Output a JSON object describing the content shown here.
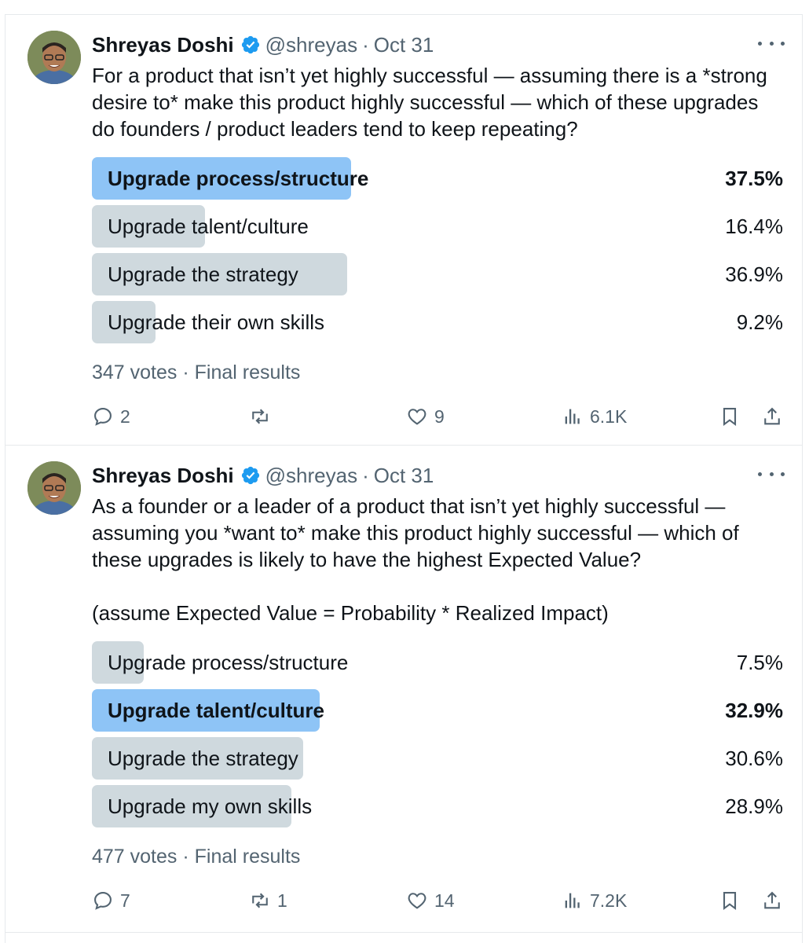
{
  "tweets": [
    {
      "author": "Shreyas Doshi",
      "handle": "@shreyas",
      "separator": "·",
      "date": "Oct 31",
      "text": "For a product that isn’t yet highly successful — assuming there is a *strong\ndesire to* make this product highly successful — which of these upgrades\ndo founders / product leaders tend to keep repeating?",
      "poll": {
        "options": [
          {
            "label": "Upgrade process/structure",
            "pct_label": "37.5%",
            "pct": 37.5,
            "winner": true
          },
          {
            "label": "Upgrade talent/culture",
            "pct_label": "16.4%",
            "pct": 16.4,
            "winner": false
          },
          {
            "label": "Upgrade the strategy",
            "pct_label": "36.9%",
            "pct": 36.9,
            "winner": false
          },
          {
            "label": "Upgrade their own skills",
            "pct_label": "9.2%",
            "pct": 9.2,
            "winner": false
          }
        ],
        "votes": "347 votes · Final results"
      },
      "actions": {
        "replies": "2",
        "reposts": "",
        "likes": "9",
        "views": "6.1K"
      }
    },
    {
      "author": "Shreyas Doshi",
      "handle": "@shreyas",
      "separator": "·",
      "date": "Oct 31",
      "text": "As a founder or a leader of a product that isn’t yet highly successful —\nassuming you *want to* make this product highly successful — which of\nthese upgrades is likely to have the highest Expected Value?\n\n(assume Expected Value = Probability * Realized Impact)",
      "poll": {
        "options": [
          {
            "label": "Upgrade process/structure",
            "pct_label": "7.5%",
            "pct": 7.5,
            "winner": false
          },
          {
            "label": "Upgrade talent/culture",
            "pct_label": "32.9%",
            "pct": 32.9,
            "winner": true
          },
          {
            "label": "Upgrade the strategy",
            "pct_label": "30.6%",
            "pct": 30.6,
            "winner": false
          },
          {
            "label": "Upgrade my own skills",
            "pct_label": "28.9%",
            "pct": 28.9,
            "winner": false
          }
        ],
        "votes": "477 votes · Final results"
      },
      "actions": {
        "replies": "7",
        "reposts": "1",
        "likes": "14",
        "views": "7.2K"
      }
    }
  ],
  "colors": {
    "verified": "#1d9bf0",
    "winner_bar": "#8ec4f6",
    "bar": "#cfd9de",
    "muted": "#536471"
  },
  "icons": [
    "reply-icon",
    "repost-icon",
    "like-icon",
    "views-icon",
    "bookmark-icon",
    "share-icon",
    "more-icon",
    "verified-icon"
  ]
}
